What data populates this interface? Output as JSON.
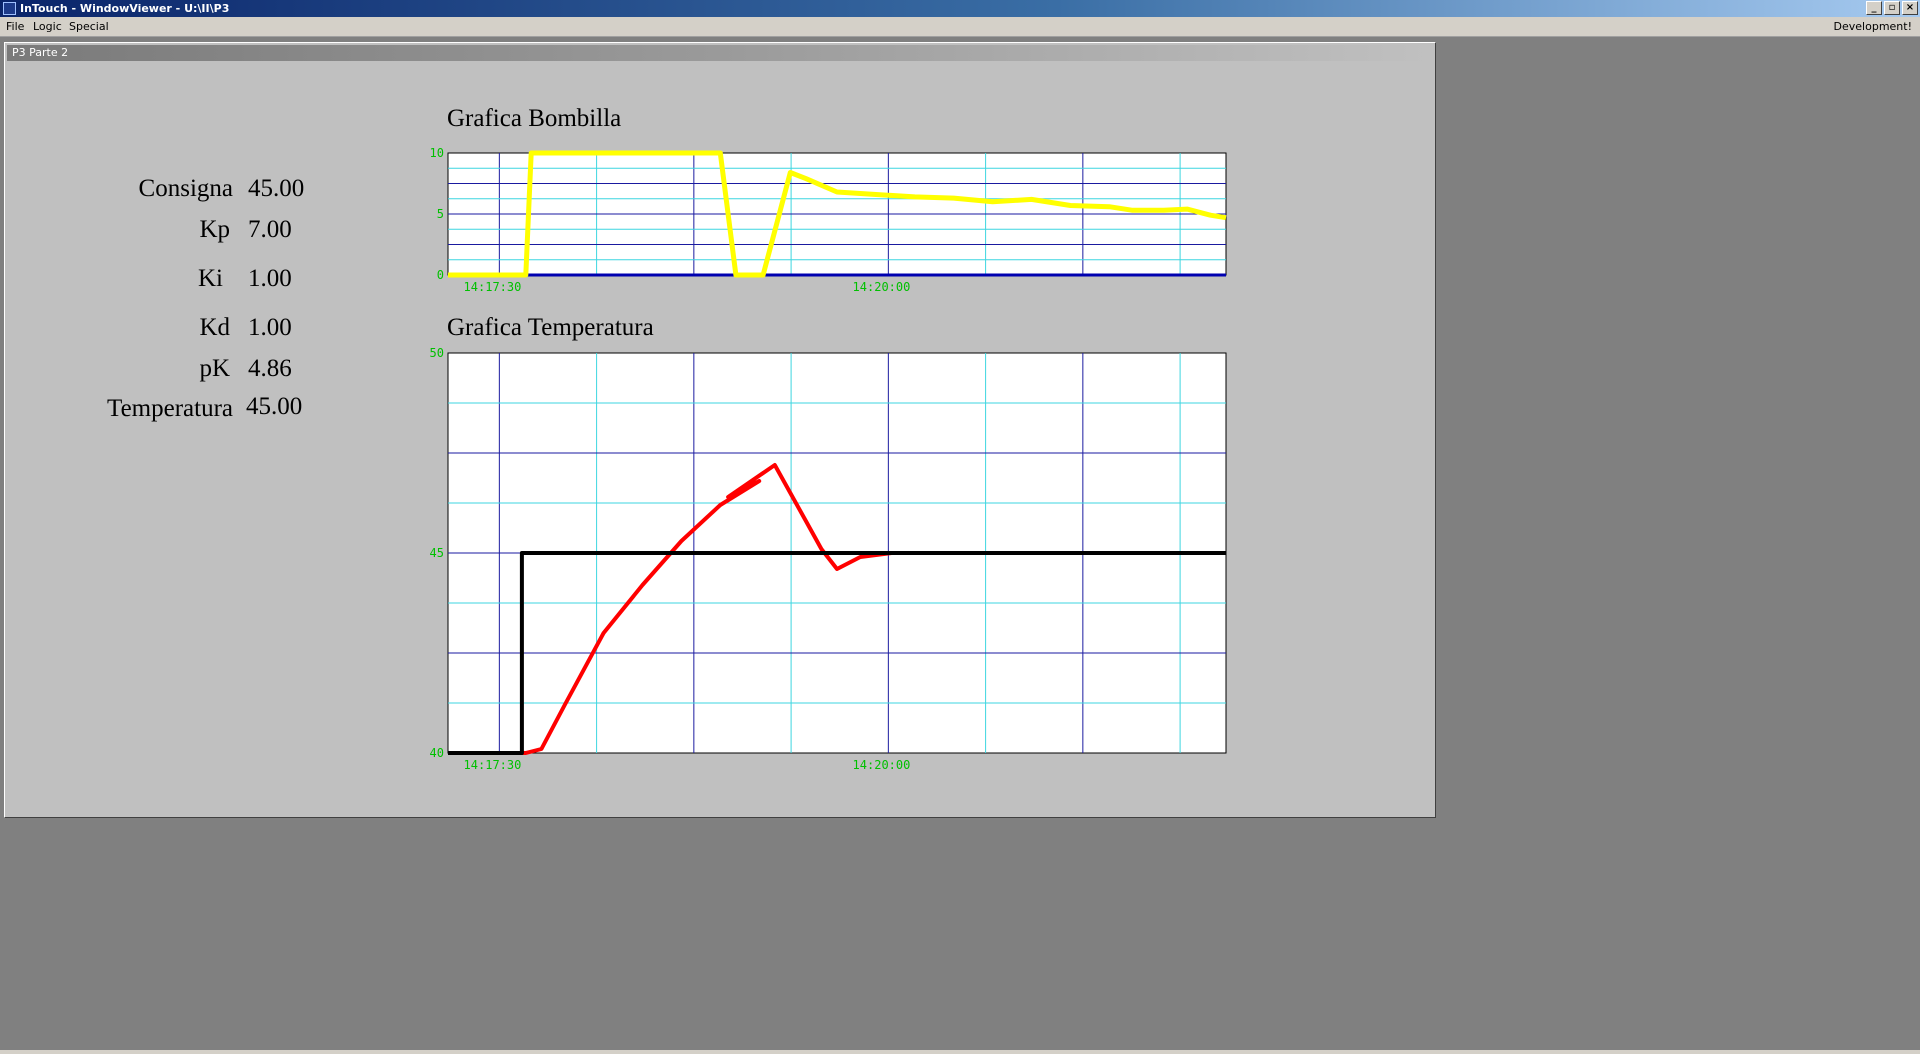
{
  "window": {
    "title": "InTouch - WindowViewer - U:\\II\\P3"
  },
  "menu": {
    "file": "File",
    "logic": "Logic",
    "special": "Special",
    "status": "Development!"
  },
  "panel": {
    "title": "P3 Parte 2"
  },
  "params": [
    {
      "label": "Consigna",
      "value": "45.00"
    },
    {
      "label": "Kp",
      "value": "7.00"
    },
    {
      "label": "Ki",
      "value": "1.00"
    },
    {
      "label": "Kd",
      "value": "1.00"
    },
    {
      "label": "pK",
      "value": "4.86"
    },
    {
      "label": "Temperatura",
      "value": "45.00"
    }
  ],
  "chart_data": [
    {
      "type": "line",
      "title": "Grafica Bombilla",
      "ylim": [
        0,
        10
      ],
      "yticks": [
        "10",
        "5",
        "0"
      ],
      "xticks": [
        "14:17:30",
        "14:20:00"
      ],
      "series": [
        {
          "color": "#ffff00",
          "points": [
            [
              0,
              0
            ],
            [
              0.1,
              0
            ],
            [
              0.107,
              10
            ],
            [
              0.35,
              10
            ],
            [
              0.37,
              0
            ],
            [
              0.405,
              0
            ],
            [
              0.44,
              8.4
            ],
            [
              0.46,
              7.9
            ],
            [
              0.5,
              6.8
            ],
            [
              0.55,
              6.6
            ],
            [
              0.6,
              6.4
            ],
            [
              0.65,
              6.3
            ],
            [
              0.7,
              6.0
            ],
            [
              0.75,
              6.2
            ],
            [
              0.8,
              5.7
            ],
            [
              0.85,
              5.6
            ],
            [
              0.88,
              5.3
            ],
            [
              0.92,
              5.3
            ],
            [
              0.95,
              5.4
            ],
            [
              0.98,
              4.9
            ],
            [
              1.0,
              4.7
            ]
          ]
        }
      ]
    },
    {
      "type": "line",
      "title": "Grafica Temperatura",
      "ylim": [
        40,
        50
      ],
      "yticks": [
        "50",
        "45",
        "40"
      ],
      "xticks": [
        "14:17:30",
        "14:20:00"
      ],
      "series": [
        {
          "color": "#ff0000",
          "points": [
            [
              0,
              40
            ],
            [
              0.1,
              40
            ],
            [
              0.12,
              40.1
            ],
            [
              0.15,
              41.2
            ],
            [
              0.2,
              43.0
            ],
            [
              0.25,
              44.2
            ],
            [
              0.3,
              45.3
            ],
            [
              0.35,
              46.2
            ],
            [
              0.4,
              46.8
            ],
            [
              0.36,
              46.4
            ],
            [
              0.42,
              47.2
            ],
            [
              0.46,
              45.8
            ],
            [
              0.48,
              45.1
            ],
            [
              0.5,
              44.6
            ],
            [
              0.53,
              44.9
            ],
            [
              0.57,
              45.0
            ],
            [
              0.65,
              45.0
            ],
            [
              0.75,
              45.0
            ],
            [
              0.85,
              45.0
            ],
            [
              1.0,
              45.0
            ]
          ]
        },
        {
          "color": "#000000",
          "points": [
            [
              0,
              40
            ],
            [
              0.095,
              40
            ],
            [
              0.095,
              45
            ],
            [
              1.0,
              45
            ]
          ]
        }
      ]
    }
  ]
}
